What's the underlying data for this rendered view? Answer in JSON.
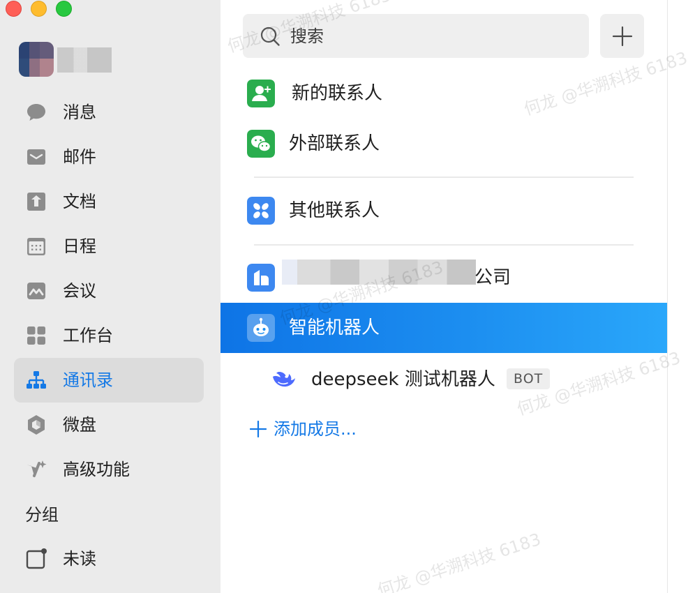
{
  "sidebar": {
    "nav": [
      {
        "key": "messages",
        "label": "消息",
        "icon": "chat-bubble-icon"
      },
      {
        "key": "mail",
        "label": "邮件",
        "icon": "mail-icon"
      },
      {
        "key": "docs",
        "label": "文档",
        "icon": "document-icon"
      },
      {
        "key": "calendar",
        "label": "日程",
        "icon": "calendar-icon"
      },
      {
        "key": "meeting",
        "label": "会议",
        "icon": "meeting-icon"
      },
      {
        "key": "workbench",
        "label": "工作台",
        "icon": "grid-icon"
      },
      {
        "key": "contacts",
        "label": "通讯录",
        "icon": "org-chart-icon",
        "active": true
      },
      {
        "key": "drive",
        "label": "微盘",
        "icon": "drive-icon"
      },
      {
        "key": "advanced",
        "label": "高级功能",
        "icon": "sparkle-icon"
      }
    ],
    "group_section_label": "分组",
    "groups": [
      {
        "label": "未读",
        "icon": "unread-icon"
      }
    ]
  },
  "contacts_panel": {
    "search_placeholder": "搜索",
    "entries": [
      {
        "label": "新的联系人",
        "icon": "add-contact-icon"
      },
      {
        "label": "外部联系人",
        "icon": "wechat-icon"
      },
      {
        "label": "其他联系人",
        "icon": "pinwheel-icon"
      },
      {
        "label": "公司",
        "icon": "company-icon"
      },
      {
        "label": "智能机器人",
        "icon": "robot-icon",
        "selected": true
      }
    ],
    "bot": {
      "name": "deepseek 测试机器人",
      "badge": "BOT",
      "icon": "deepseek-whale-icon"
    },
    "add_member_label": "添加成员..."
  },
  "watermark_text": "何龙 @华溯科技 6183",
  "colors": {
    "accent": "#1479e6",
    "selected_gradient_start": "#0e74e6",
    "selected_gradient_end": "#2aa7fa",
    "sidebar_bg": "#ebebeb"
  }
}
